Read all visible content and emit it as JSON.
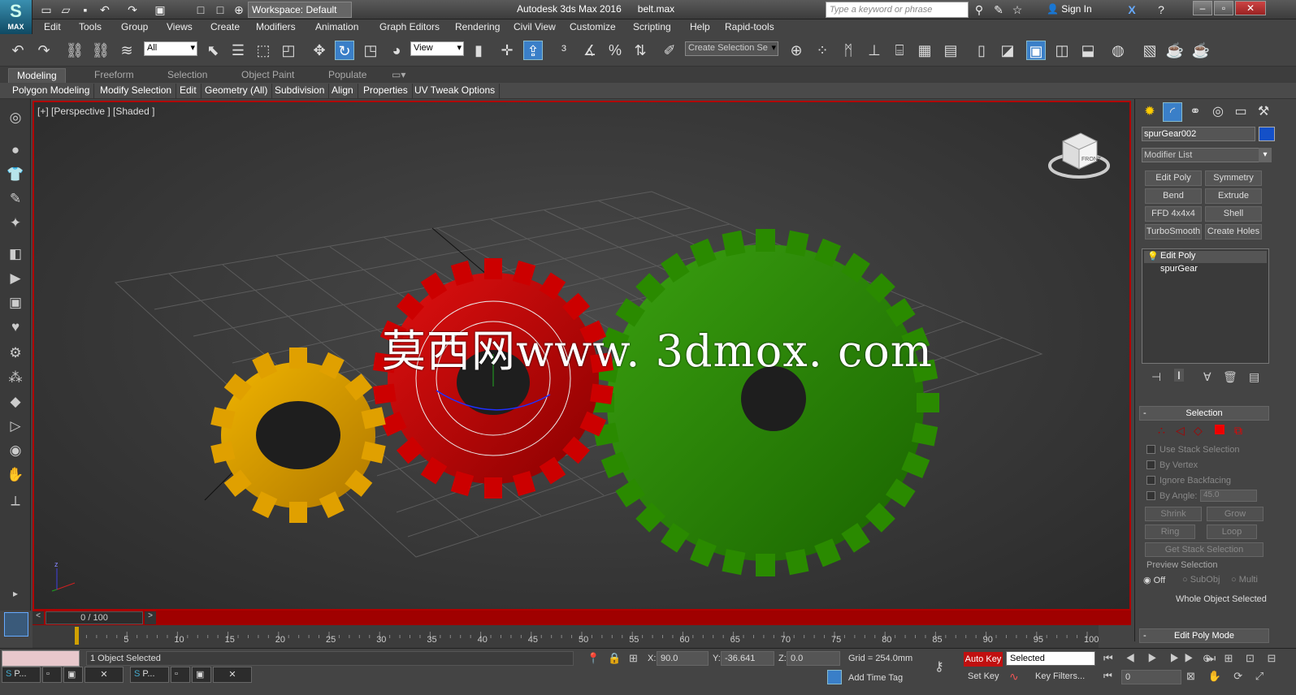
{
  "app": {
    "logo_label": "MAX",
    "title": "Autodesk 3ds Max 2016",
    "file": "belt.max",
    "workspace": "Workspace: Default",
    "search_placeholder": "Type a keyword or phrase",
    "sign_in": "Sign In"
  },
  "menu": [
    "Edit",
    "Tools",
    "Group",
    "Views",
    "Create",
    "Modifiers",
    "Animation",
    "Graph Editors",
    "Rendering",
    "Civil View",
    "Customize",
    "Scripting",
    "Help",
    "Rapid-tools"
  ],
  "toolbar": {
    "selection_filter": "All",
    "ref_coord": "View",
    "named_selection": "Create Selection Se"
  },
  "ribbon": {
    "tabs": [
      "Modeling",
      "Freeform",
      "Selection",
      "Object Paint",
      "Populate"
    ],
    "items": [
      "Polygon Modeling",
      "Modify Selection",
      "Edit",
      "Geometry (All)",
      "Subdivision",
      "Align",
      "Properties",
      "UV Tweak Options"
    ]
  },
  "viewport": {
    "label": "[+] [Perspective ] [Shaded ]",
    "watermark": "莫西网www. 3dmox. com",
    "gear_colors": {
      "yellow": "#e0a000",
      "red": "#cc0000",
      "green": "#2a8a00"
    },
    "viewcube_face": "FRONT"
  },
  "panel": {
    "object_name": "spurGear002",
    "object_color": "#1450c8",
    "modifier_list": "Modifier List",
    "mod_buttons": [
      "Edit Poly",
      "Symmetry",
      "Bend",
      "Extrude",
      "FFD 4x4x4",
      "Shell",
      "TurboSmooth",
      "Create Holes"
    ],
    "stack": [
      "Edit Poly",
      "spurGear"
    ],
    "selection_title": "Selection",
    "checks": [
      "Use Stack Selection",
      "By Vertex",
      "Ignore Backfacing",
      "By Angle:"
    ],
    "by_angle": "45.0",
    "shrink": "Shrink",
    "grow": "Grow",
    "ring": "Ring",
    "loop": "Loop",
    "get_stack": "Get Stack Selection",
    "preview_title": "Preview Selection",
    "preview_opts": [
      "Off",
      "SubObj",
      "Multi"
    ],
    "whole_obj": "Whole Object Selected",
    "edit_poly_mode": "Edit Poly Mode"
  },
  "timeline": {
    "frame": "0 / 100",
    "ticks": [
      "0",
      "5",
      "10",
      "15",
      "20",
      "25",
      "30",
      "35",
      "40",
      "45",
      "50",
      "55",
      "60",
      "65",
      "70",
      "75",
      "80",
      "85",
      "90",
      "95",
      "100"
    ]
  },
  "status": {
    "selected": "1 Object Selected",
    "x_label": "X:",
    "x": "90.0",
    "y_label": "Y:",
    "y": "-36.641",
    "z_label": "Z:",
    "z": "0.0",
    "grid": "Grid = 254.0mm",
    "auto_key": "Auto Key",
    "set_key": "Set Key",
    "key_mode": "Selected",
    "key_filters": "Key Filters...",
    "add_time_tag": "Add Time Tag",
    "frame_field": "0",
    "task1": "P...",
    "task2": "P..."
  }
}
